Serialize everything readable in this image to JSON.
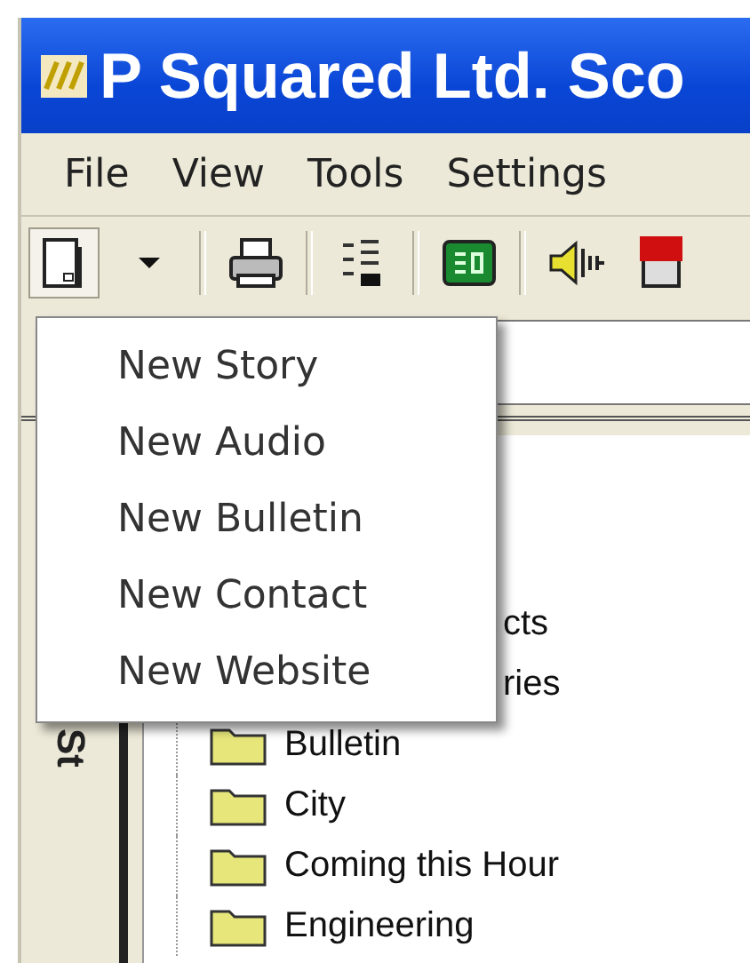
{
  "window": {
    "title": "P Squared Ltd. Sco"
  },
  "menu_bar": [
    {
      "label": "File"
    },
    {
      "label": "View"
    },
    {
      "label": "Tools"
    },
    {
      "label": "Settings"
    }
  ],
  "toolbar": {
    "new_button": {
      "pressed": true
    }
  },
  "new_menu": {
    "open": true,
    "items": [
      {
        "label": "New Story"
      },
      {
        "label": "New Audio"
      },
      {
        "label": "New Bulletin"
      },
      {
        "label": "New Contact"
      },
      {
        "label": "New Website"
      }
    ]
  },
  "side_tab": {
    "label": "St"
  },
  "tree": {
    "items": [
      {
        "label": "cts",
        "kind": "fragment"
      },
      {
        "label": "ries",
        "kind": "fragment"
      },
      {
        "label": "Bulletin",
        "kind": "folder"
      },
      {
        "label": "City",
        "kind": "folder"
      },
      {
        "label": "Coming this Hour",
        "kind": "folder"
      },
      {
        "label": "Engineering",
        "kind": "folder"
      }
    ]
  }
}
